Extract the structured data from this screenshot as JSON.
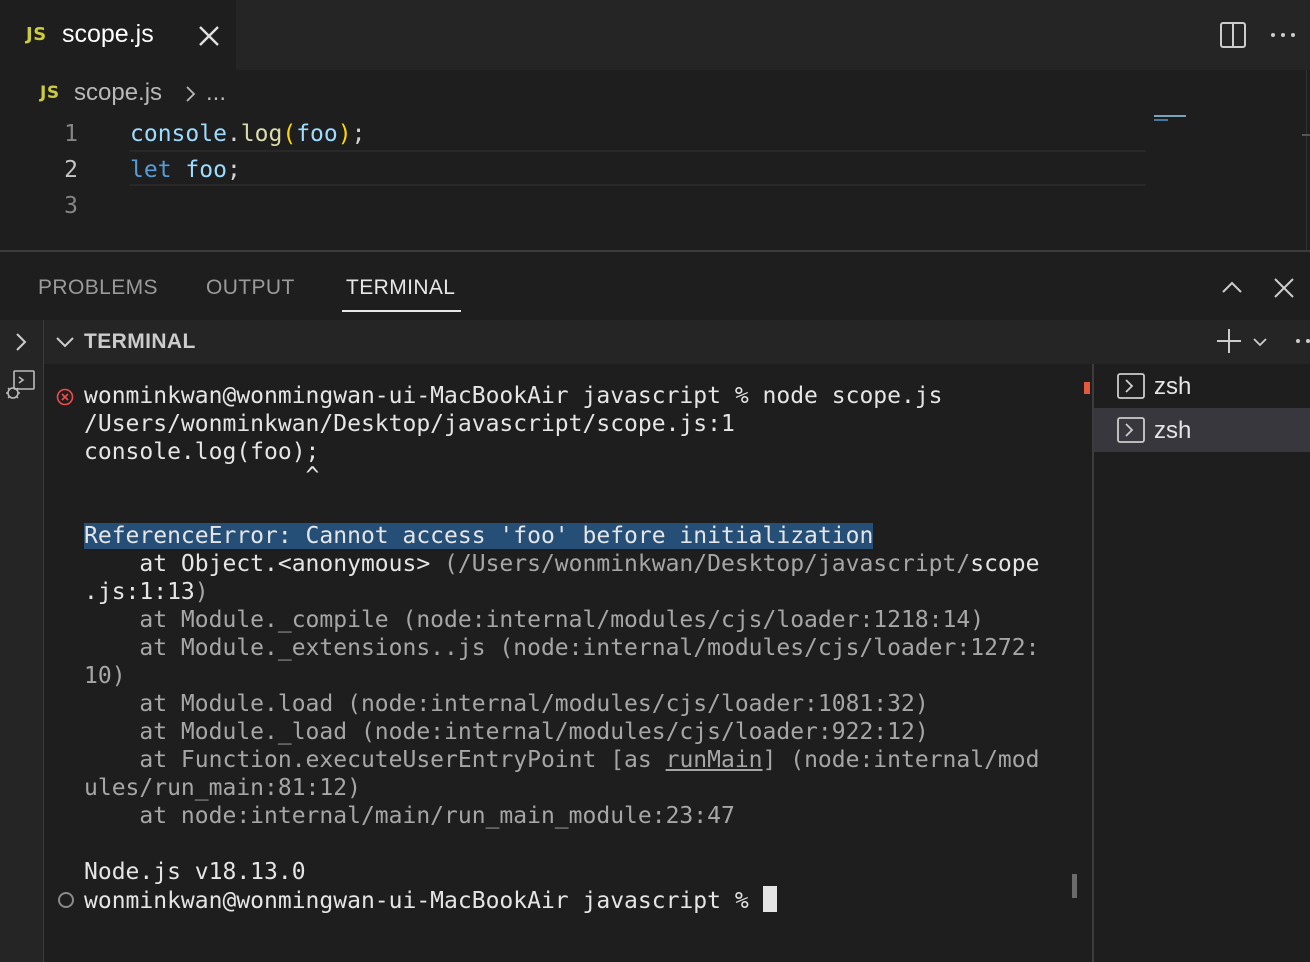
{
  "editor_tab": {
    "badge": "JS",
    "title": "scope.js"
  },
  "breadcrumb": {
    "badge": "JS",
    "file": "scope.js",
    "more": "..."
  },
  "editor": {
    "lines": [
      {
        "number": "1"
      },
      {
        "number": "2"
      },
      {
        "number": "3"
      }
    ],
    "line1": {
      "t1": "console",
      "t2": ".",
      "t3": "log",
      "t4": "(",
      "t5": "foo",
      "t6": ")",
      "t7": ";"
    },
    "line2": {
      "t1": "let",
      "t2": " ",
      "t3": "foo",
      "t4": ";"
    }
  },
  "panel": {
    "tabs": [
      "PROBLEMS",
      "OUTPUT",
      "TERMINAL"
    ],
    "active_tab": "TERMINAL"
  },
  "terminal_header": {
    "title": "TERMINAL"
  },
  "terminal": {
    "l1": "wonminkwan@wonmingwan-ui-MacBookAir javascript % node scope.js",
    "l2": "/Users/wonminkwan/Desktop/javascript/scope.js:1",
    "l3": "console.log(foo);",
    "l4": "                ^",
    "l5": "ReferenceError: Cannot access 'foo' before initialization",
    "l6a": "    at Object.<anonymous> ",
    "l6b": "(/Users/wonminkwan/Desktop/javascript/",
    "l6c": "scope",
    "l7a": ".js:1:13",
    "l7b": ")",
    "l8": "    at Module._compile (node:internal/modules/cjs/loader:1218:14)",
    "l9": "    at Module._extensions..js (node:internal/modules/cjs/loader:1272:",
    "l10": "10)",
    "l11": "    at Module.load (node:internal/modules/cjs/loader:1081:32)",
    "l12": "    at Module._load (node:internal/modules/cjs/loader:922:12)",
    "l13a": "    at Function.executeUserEntryPoint [as ",
    "l13b": "runMain",
    "l13c": "] (node:internal/mod",
    "l14": "ules/run_main:81:12)",
    "l15": "    at node:internal/main/run_main_module:23:47",
    "l16": "Node.js v18.13.0",
    "l17": "wonminkwan@wonmingwan-ui-MacBookAir javascript % "
  },
  "terminal_list": [
    {
      "label": "zsh"
    },
    {
      "label": "zsh"
    }
  ],
  "colors": {
    "accent_js": "#cbcb41",
    "error": "#f14c4c",
    "selection": "#264f78"
  }
}
